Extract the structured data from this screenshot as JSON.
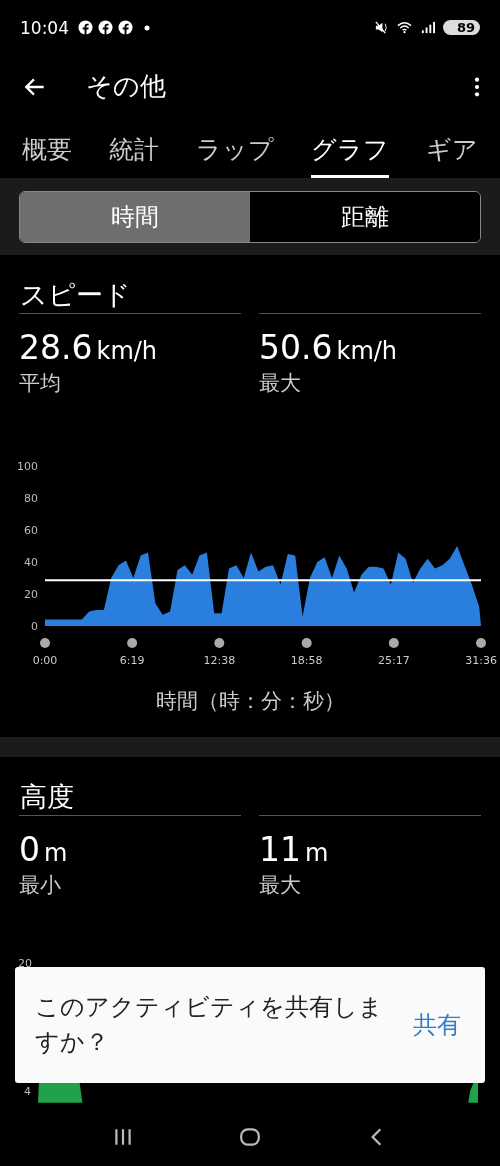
{
  "status_bar": {
    "time": "10:04",
    "battery": "89"
  },
  "app_bar": {
    "title": "その他"
  },
  "tabs": [
    {
      "label": "概要",
      "selected": false
    },
    {
      "label": "統計",
      "selected": false
    },
    {
      "label": "ラップ",
      "selected": false
    },
    {
      "label": "グラフ",
      "selected": true
    },
    {
      "label": "ギア",
      "selected": false
    }
  ],
  "segments": [
    {
      "label": "時間",
      "selected": true
    },
    {
      "label": "距離",
      "selected": false
    }
  ],
  "speed": {
    "title": "スピード",
    "stats": [
      {
        "value": "28.6",
        "unit": "km/h",
        "label": "平均"
      },
      {
        "value": "50.6",
        "unit": "km/h",
        "label": "最大"
      }
    ],
    "chart_data": {
      "type": "area",
      "xlabel": "時間（時：分：秒）",
      "xlim": [
        0,
        1896
      ],
      "ylim": [
        0,
        100
      ],
      "yticks": [
        0,
        20,
        40,
        60,
        80,
        100
      ],
      "xticks": [
        {
          "value": 0,
          "label": "0:00"
        },
        {
          "value": 379,
          "label": "6:19"
        },
        {
          "value": 758,
          "label": "12:38"
        },
        {
          "value": 1138,
          "label": "18:58"
        },
        {
          "value": 1517,
          "label": "25:17"
        },
        {
          "value": 1896,
          "label": "31:36"
        }
      ],
      "x": [
        0,
        32,
        64,
        96,
        128,
        160,
        192,
        224,
        256,
        288,
        320,
        352,
        384,
        416,
        448,
        480,
        512,
        544,
        576,
        608,
        640,
        672,
        704,
        736,
        768,
        800,
        832,
        864,
        896,
        928,
        960,
        992,
        1024,
        1056,
        1088,
        1120,
        1152,
        1184,
        1216,
        1248,
        1280,
        1312,
        1344,
        1376,
        1408,
        1440,
        1472,
        1504,
        1536,
        1568,
        1600,
        1632,
        1664,
        1696,
        1728,
        1760,
        1792,
        1824,
        1856,
        1888,
        1896
      ],
      "series": [
        {
          "color": "#2a7fde",
          "values": [
            4,
            4,
            4,
            4,
            4,
            4,
            9,
            10,
            10,
            30,
            38,
            41,
            30,
            44,
            46,
            14,
            7,
            9,
            35,
            38,
            32,
            44,
            46,
            8,
            8,
            36,
            38,
            30,
            46,
            34,
            37,
            38,
            26,
            45,
            44,
            6,
            30,
            40,
            43,
            30,
            44,
            36,
            21,
            32,
            37,
            37,
            36,
            26,
            46,
            42,
            27,
            36,
            42,
            36,
            38,
            42,
            50,
            38,
            26,
            12,
            0
          ]
        },
        {
          "type": "line",
          "color": "#ffffff",
          "values": [
            28.6,
            28.6,
            28.6,
            28.6,
            28.6,
            28.6,
            28.6,
            28.6,
            28.6,
            28.6,
            28.6,
            28.6,
            28.6,
            28.6,
            28.6,
            28.6,
            28.6,
            28.6,
            28.6,
            28.6,
            28.6,
            28.6,
            28.6,
            28.6,
            28.6,
            28.6,
            28.6,
            28.6,
            28.6,
            28.6,
            28.6,
            28.6,
            28.6,
            28.6,
            28.6,
            28.6,
            28.6,
            28.6,
            28.6,
            28.6,
            28.6,
            28.6,
            28.6,
            28.6,
            28.6,
            28.6,
            28.6,
            28.6,
            28.6,
            28.6,
            28.6,
            28.6,
            28.6,
            28.6,
            28.6,
            28.6,
            28.6,
            28.6,
            28.6,
            28.6,
            28.6
          ]
        }
      ]
    }
  },
  "altitude": {
    "title": "高度",
    "stats": [
      {
        "value": "0",
        "unit": "m",
        "label": "最小"
      },
      {
        "value": "11",
        "unit": "m",
        "label": "最大"
      }
    ],
    "axis_labels": [
      "20",
      "4"
    ]
  },
  "snackbar": {
    "message": "このアクティビティを共有しますか？",
    "action": "共有"
  }
}
